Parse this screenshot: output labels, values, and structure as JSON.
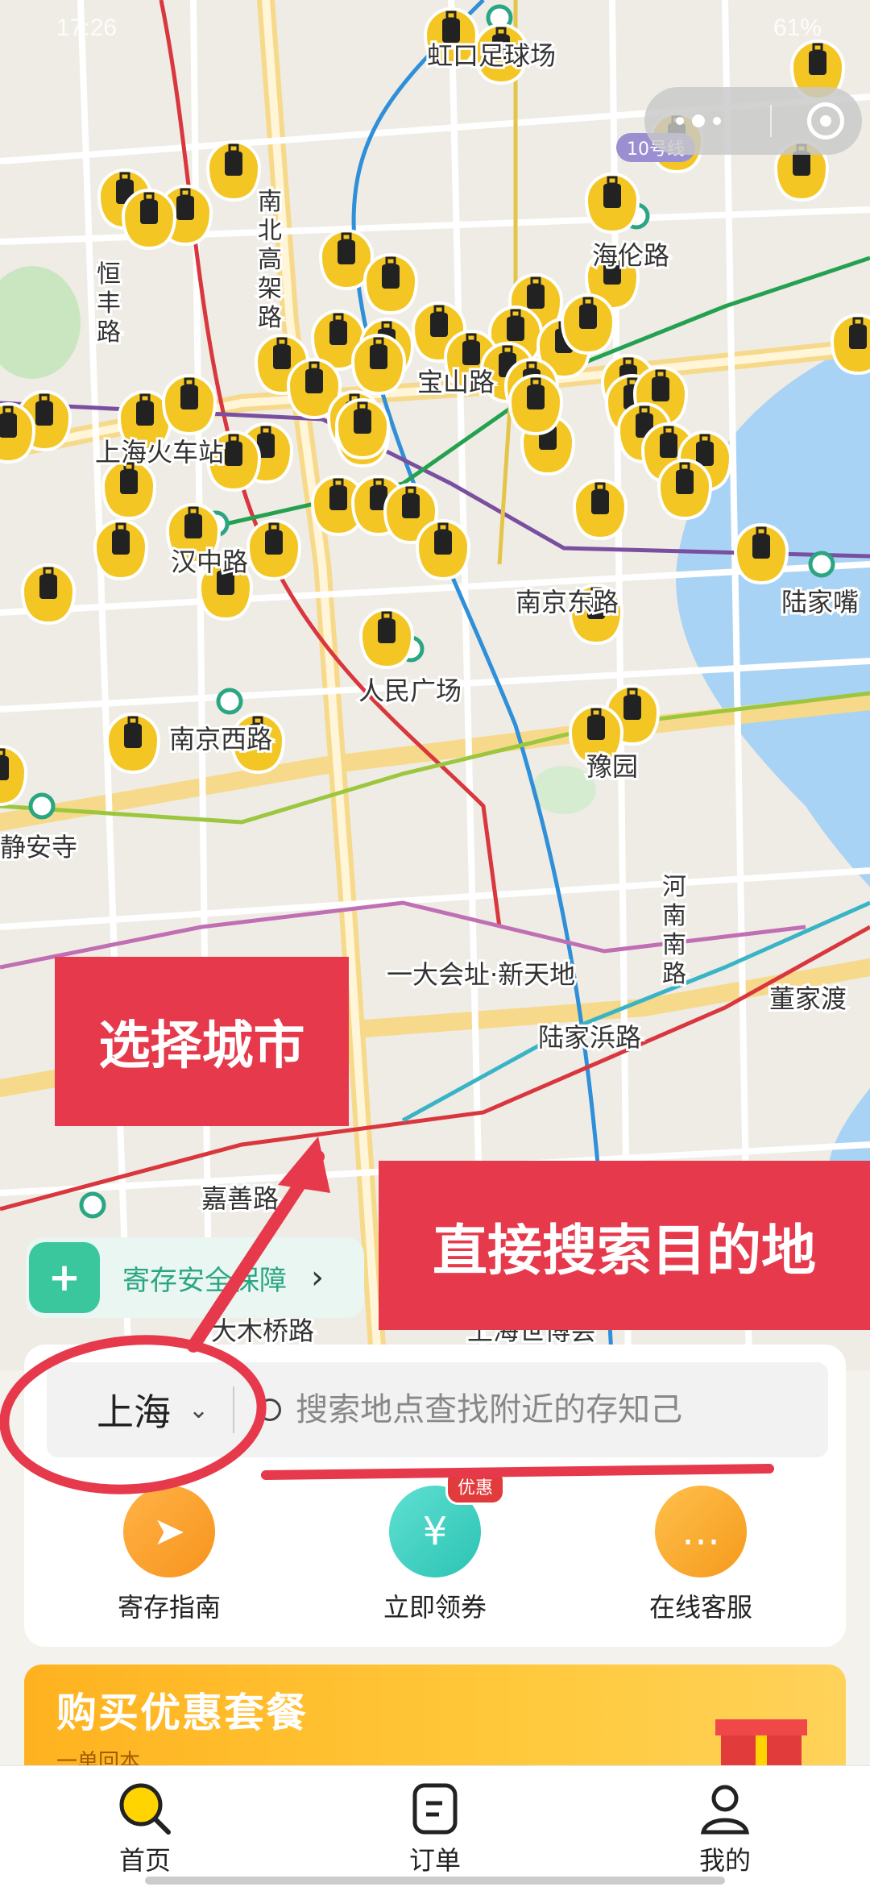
{
  "status_bar": {
    "time": "17:26",
    "right_text": "61%"
  },
  "map": {
    "line_badge": "10号线",
    "labels": [
      {
        "text": "虹口足球场"
      },
      {
        "text": "南北高架路"
      },
      {
        "text": "海伦路"
      },
      {
        "text": "宝山路"
      },
      {
        "text": "上海火车站"
      },
      {
        "text": "汉中路"
      },
      {
        "text": "陆家嘴"
      },
      {
        "text": "南京东路"
      },
      {
        "text": "人民广场"
      },
      {
        "text": "南京西路"
      },
      {
        "text": "豫园"
      },
      {
        "text": "静安寺"
      },
      {
        "text": "河南南路"
      },
      {
        "text": "一大会址·新天地"
      },
      {
        "text": "陆家浜路"
      },
      {
        "text": "董家渡"
      },
      {
        "text": "嘉善路"
      },
      {
        "text": "大木桥路"
      },
      {
        "text": "上海世博会"
      },
      {
        "text": "恒丰路"
      }
    ]
  },
  "safety_banner": {
    "label": "寄存安全保障",
    "arrow": "›"
  },
  "search": {
    "city": "上海",
    "placeholder": "搜索地点查找附近的存知己"
  },
  "features": [
    {
      "label": "寄存指南",
      "color": "#f7a224"
    },
    {
      "label": "立即领券",
      "color": "#3fd0c0",
      "badge": "优惠"
    },
    {
      "label": "在线客服",
      "color": "#f5a623"
    }
  ],
  "promo": {
    "title": "购买优惠套餐",
    "subtitle": "一单回本"
  },
  "tabs": [
    {
      "label": "首页",
      "active": true
    },
    {
      "label": "订单",
      "active": false
    },
    {
      "label": "我的",
      "active": false
    }
  ],
  "annotations": {
    "choose_city": "选择城市",
    "search_destination": "直接搜索目的地"
  },
  "colors": {
    "accent": "#ffd400",
    "annotation": "#e63a4c",
    "safety": "#3bc79e"
  }
}
